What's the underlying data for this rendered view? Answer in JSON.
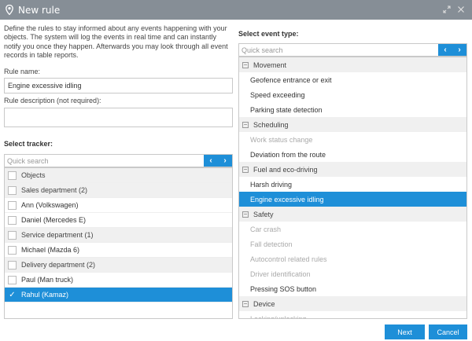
{
  "window": {
    "title": "New rule"
  },
  "left": {
    "description": "Define the rules to stay informed about any events happening with your objects. The system will log the events in real time and can instantly notify you once they happen. Afterwards you may look through all event records in table reports.",
    "rule_name_label": "Rule name:",
    "rule_name_value": "Engine excessive idling",
    "rule_desc_label": "Rule description (not required):",
    "rule_desc_value": "",
    "select_tracker_label": "Select tracker:",
    "search_placeholder": "Quick search",
    "objects_header": "Objects",
    "rows": [
      {
        "type": "group",
        "label": "Sales department (2)"
      },
      {
        "type": "item",
        "label": "Ann (Volkswagen)"
      },
      {
        "type": "item",
        "label": "Daniel (Mercedes E)"
      },
      {
        "type": "group",
        "label": "Service department (1)"
      },
      {
        "type": "item",
        "label": "Michael (Mazda 6)"
      },
      {
        "type": "group",
        "label": "Delivery department (2)"
      },
      {
        "type": "item",
        "label": "Paul (Man truck)"
      },
      {
        "type": "item",
        "label": "Rahul (Kamaz)",
        "selected": true
      }
    ]
  },
  "right": {
    "select_event_label": "Select event type:",
    "search_placeholder": "Quick search",
    "rows": [
      {
        "type": "cat",
        "label": "Movement"
      },
      {
        "type": "item",
        "label": "Geofence entrance or exit"
      },
      {
        "type": "item",
        "label": "Speed exceeding"
      },
      {
        "type": "item",
        "label": "Parking state detection"
      },
      {
        "type": "cat",
        "label": "Scheduling"
      },
      {
        "type": "item",
        "label": "Work status change",
        "disabled": true
      },
      {
        "type": "item",
        "label": "Deviation from the route"
      },
      {
        "type": "cat",
        "label": "Fuel and eco-driving"
      },
      {
        "type": "item",
        "label": "Harsh driving"
      },
      {
        "type": "item",
        "label": "Engine excessive idling",
        "selected": true
      },
      {
        "type": "cat",
        "label": "Safety"
      },
      {
        "type": "item",
        "label": "Car crash",
        "disabled": true
      },
      {
        "type": "item",
        "label": "Fall detection",
        "disabled": true
      },
      {
        "type": "item",
        "label": "Autocontrol related rules",
        "disabled": true
      },
      {
        "type": "item",
        "label": "Driver identification",
        "disabled": true
      },
      {
        "type": "item",
        "label": "Pressing SOS button"
      },
      {
        "type": "cat",
        "label": "Device"
      },
      {
        "type": "item",
        "label": "Locking/unlocking",
        "disabled": true
      }
    ]
  },
  "footer": {
    "next_label": "Next",
    "cancel_label": "Cancel"
  },
  "colors": {
    "titlebar": "#868e96",
    "accent": "#1e8fd8",
    "group_bg": "#f0f0f0"
  },
  "icons": {
    "title": "map-pin-icon",
    "expand": "expand-icon",
    "close": "close-icon",
    "prev": "chevron-left-icon",
    "next": "chevron-right-icon",
    "check": "check-icon",
    "collapse": "minus-icon"
  }
}
